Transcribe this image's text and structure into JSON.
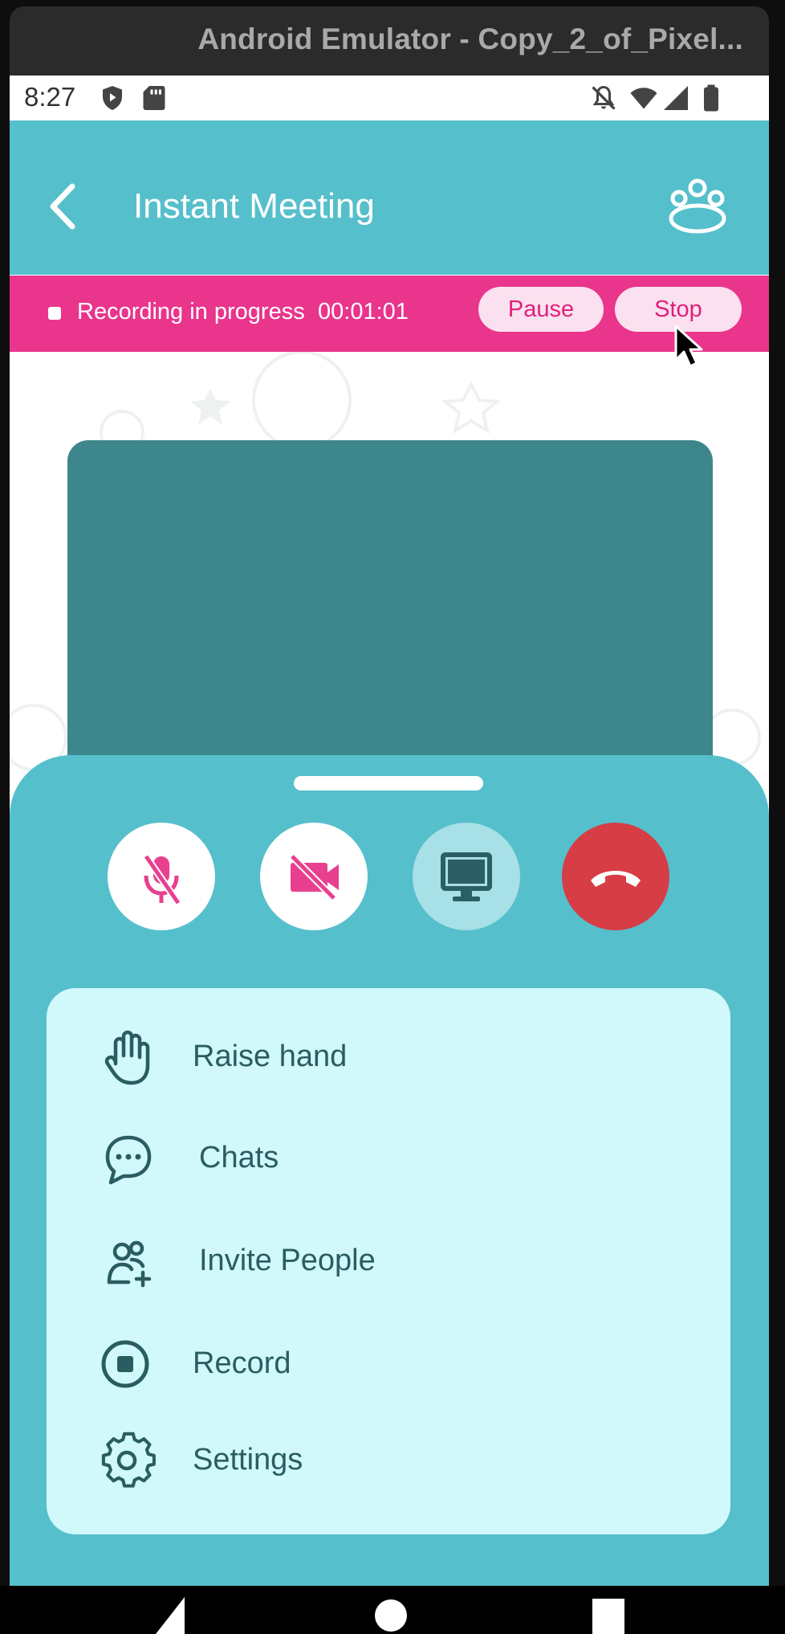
{
  "window": {
    "title": "Android Emulator - Copy_2_of_Pixel..."
  },
  "status_bar": {
    "time": "8:27"
  },
  "app_bar": {
    "title": "Instant Meeting"
  },
  "recording_bar": {
    "status": "Recording in progress",
    "timer": "00:01:01",
    "pause_label": "Pause",
    "stop_label": "Stop"
  },
  "controls": {
    "mic": "muted",
    "camera": "off",
    "screen_share": "available",
    "end_call": "end-call"
  },
  "menu": {
    "items": [
      {
        "label": "Raise hand",
        "icon": "raise-hand-icon"
      },
      {
        "label": "Chats",
        "icon": "chat-icon"
      },
      {
        "label": "Invite People",
        "icon": "invite-people-icon"
      },
      {
        "label": "Record",
        "icon": "record-icon"
      },
      {
        "label": "Settings",
        "icon": "settings-icon"
      }
    ]
  },
  "colors": {
    "teal": "#56bfcc",
    "pink": "#e9358c",
    "menu_bg": "#d1f8fb",
    "video_tile": "#3d868c",
    "end_call": "#d63d44"
  }
}
